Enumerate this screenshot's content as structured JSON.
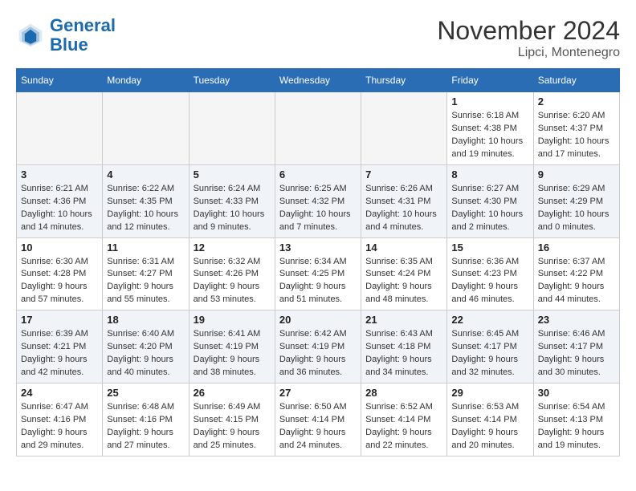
{
  "header": {
    "logo_line1": "General",
    "logo_line2": "Blue",
    "month": "November 2024",
    "location": "Lipci, Montenegro"
  },
  "weekdays": [
    "Sunday",
    "Monday",
    "Tuesday",
    "Wednesday",
    "Thursday",
    "Friday",
    "Saturday"
  ],
  "weeks": [
    [
      {
        "day": "",
        "info": ""
      },
      {
        "day": "",
        "info": ""
      },
      {
        "day": "",
        "info": ""
      },
      {
        "day": "",
        "info": ""
      },
      {
        "day": "",
        "info": ""
      },
      {
        "day": "1",
        "info": "Sunrise: 6:18 AM\nSunset: 4:38 PM\nDaylight: 10 hours and 19 minutes."
      },
      {
        "day": "2",
        "info": "Sunrise: 6:20 AM\nSunset: 4:37 PM\nDaylight: 10 hours and 17 minutes."
      }
    ],
    [
      {
        "day": "3",
        "info": "Sunrise: 6:21 AM\nSunset: 4:36 PM\nDaylight: 10 hours and 14 minutes."
      },
      {
        "day": "4",
        "info": "Sunrise: 6:22 AM\nSunset: 4:35 PM\nDaylight: 10 hours and 12 minutes."
      },
      {
        "day": "5",
        "info": "Sunrise: 6:24 AM\nSunset: 4:33 PM\nDaylight: 10 hours and 9 minutes."
      },
      {
        "day": "6",
        "info": "Sunrise: 6:25 AM\nSunset: 4:32 PM\nDaylight: 10 hours and 7 minutes."
      },
      {
        "day": "7",
        "info": "Sunrise: 6:26 AM\nSunset: 4:31 PM\nDaylight: 10 hours and 4 minutes."
      },
      {
        "day": "8",
        "info": "Sunrise: 6:27 AM\nSunset: 4:30 PM\nDaylight: 10 hours and 2 minutes."
      },
      {
        "day": "9",
        "info": "Sunrise: 6:29 AM\nSunset: 4:29 PM\nDaylight: 10 hours and 0 minutes."
      }
    ],
    [
      {
        "day": "10",
        "info": "Sunrise: 6:30 AM\nSunset: 4:28 PM\nDaylight: 9 hours and 57 minutes."
      },
      {
        "day": "11",
        "info": "Sunrise: 6:31 AM\nSunset: 4:27 PM\nDaylight: 9 hours and 55 minutes."
      },
      {
        "day": "12",
        "info": "Sunrise: 6:32 AM\nSunset: 4:26 PM\nDaylight: 9 hours and 53 minutes."
      },
      {
        "day": "13",
        "info": "Sunrise: 6:34 AM\nSunset: 4:25 PM\nDaylight: 9 hours and 51 minutes."
      },
      {
        "day": "14",
        "info": "Sunrise: 6:35 AM\nSunset: 4:24 PM\nDaylight: 9 hours and 48 minutes."
      },
      {
        "day": "15",
        "info": "Sunrise: 6:36 AM\nSunset: 4:23 PM\nDaylight: 9 hours and 46 minutes."
      },
      {
        "day": "16",
        "info": "Sunrise: 6:37 AM\nSunset: 4:22 PM\nDaylight: 9 hours and 44 minutes."
      }
    ],
    [
      {
        "day": "17",
        "info": "Sunrise: 6:39 AM\nSunset: 4:21 PM\nDaylight: 9 hours and 42 minutes."
      },
      {
        "day": "18",
        "info": "Sunrise: 6:40 AM\nSunset: 4:20 PM\nDaylight: 9 hours and 40 minutes."
      },
      {
        "day": "19",
        "info": "Sunrise: 6:41 AM\nSunset: 4:19 PM\nDaylight: 9 hours and 38 minutes."
      },
      {
        "day": "20",
        "info": "Sunrise: 6:42 AM\nSunset: 4:19 PM\nDaylight: 9 hours and 36 minutes."
      },
      {
        "day": "21",
        "info": "Sunrise: 6:43 AM\nSunset: 4:18 PM\nDaylight: 9 hours and 34 minutes."
      },
      {
        "day": "22",
        "info": "Sunrise: 6:45 AM\nSunset: 4:17 PM\nDaylight: 9 hours and 32 minutes."
      },
      {
        "day": "23",
        "info": "Sunrise: 6:46 AM\nSunset: 4:17 PM\nDaylight: 9 hours and 30 minutes."
      }
    ],
    [
      {
        "day": "24",
        "info": "Sunrise: 6:47 AM\nSunset: 4:16 PM\nDaylight: 9 hours and 29 minutes."
      },
      {
        "day": "25",
        "info": "Sunrise: 6:48 AM\nSunset: 4:16 PM\nDaylight: 9 hours and 27 minutes."
      },
      {
        "day": "26",
        "info": "Sunrise: 6:49 AM\nSunset: 4:15 PM\nDaylight: 9 hours and 25 minutes."
      },
      {
        "day": "27",
        "info": "Sunrise: 6:50 AM\nSunset: 4:14 PM\nDaylight: 9 hours and 24 minutes."
      },
      {
        "day": "28",
        "info": "Sunrise: 6:52 AM\nSunset: 4:14 PM\nDaylight: 9 hours and 22 minutes."
      },
      {
        "day": "29",
        "info": "Sunrise: 6:53 AM\nSunset: 4:14 PM\nDaylight: 9 hours and 20 minutes."
      },
      {
        "day": "30",
        "info": "Sunrise: 6:54 AM\nSunset: 4:13 PM\nDaylight: 9 hours and 19 minutes."
      }
    ]
  ]
}
